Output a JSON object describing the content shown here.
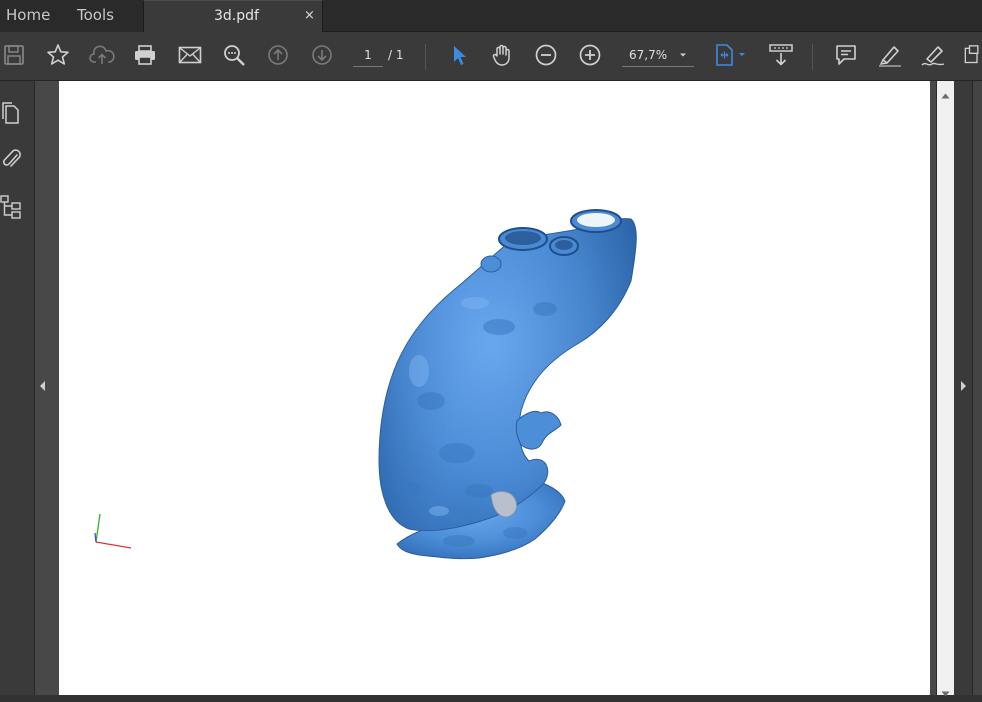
{
  "tabs": {
    "home": "Home",
    "tools": "Tools",
    "document": "3d.pdf",
    "close_symbol": "×"
  },
  "toolbar": {
    "page_current": "1",
    "page_total": "/ 1",
    "zoom": "67,7%",
    "icons": [
      "save-icon",
      "bookmark-star-icon",
      "upload-cloud-icon",
      "print-icon",
      "email-icon",
      "search-icon",
      "prev-page-icon",
      "next-page-icon",
      "select-arrow-icon",
      "hand-tool-icon",
      "zoom-out-icon",
      "zoom-in-icon",
      "fit-page-icon",
      "scroll-mode-icon",
      "comment-icon",
      "highlight-icon",
      "sign-icon",
      "export-icon"
    ]
  },
  "left_nav": {
    "icons": [
      "page-thumbnails-icon",
      "attachments-icon",
      "model-tree-icon"
    ]
  },
  "viewer": {
    "content": "3d-model-aorta",
    "model_color": "#4f90d9",
    "axes_colors": {
      "x": "#e03030",
      "y": "#30b030",
      "z": "#3050e0"
    }
  }
}
